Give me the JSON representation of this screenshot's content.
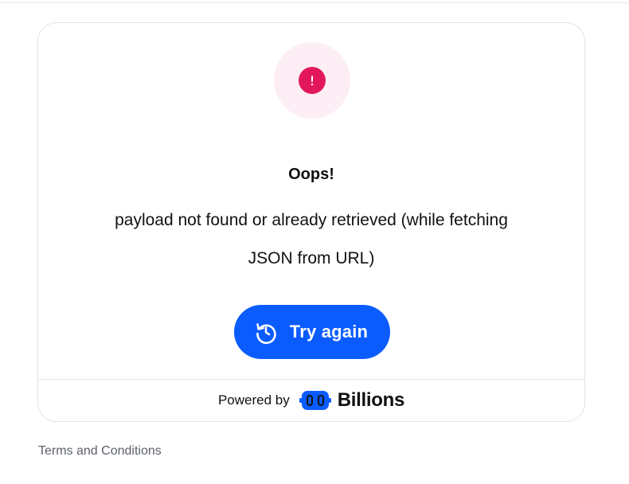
{
  "error": {
    "title": "Oops!",
    "message": "payload not found or already retrieved (while fetching JSON from URL)"
  },
  "actions": {
    "retry_label": "Try again",
    "retry_icon": "retry-icon"
  },
  "footer": {
    "powered_by": "Powered by",
    "brand_name": "Billions",
    "brand_icon": "billions-logo-icon"
  },
  "links": {
    "terms": "Terms and Conditions"
  },
  "colors": {
    "accent": "#0a5cff",
    "error": "#e2175a",
    "error_halo": "#fdeef6",
    "muted_text": "#5b5f6b"
  }
}
